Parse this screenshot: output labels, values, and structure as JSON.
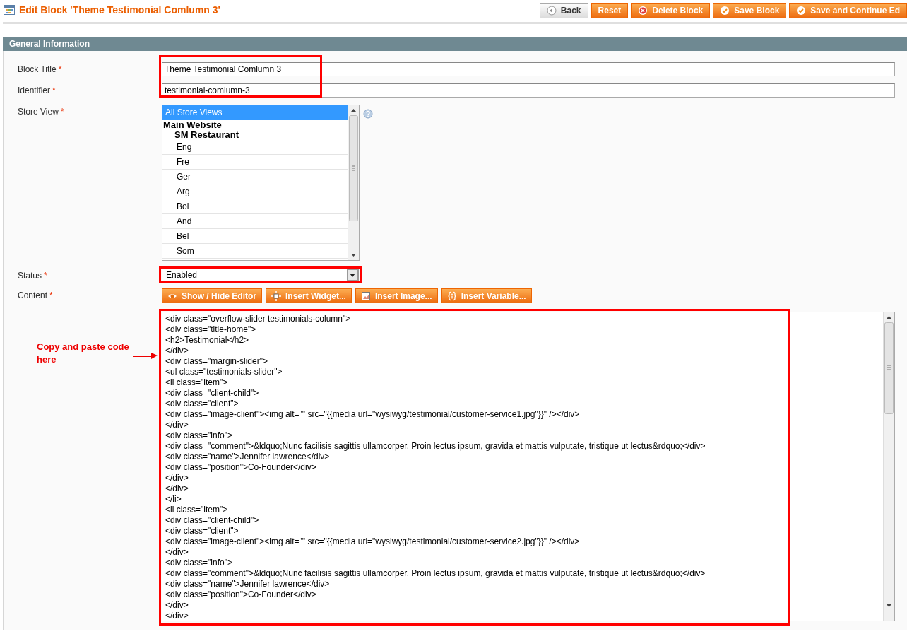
{
  "header": {
    "title": "Edit Block 'Theme Testimonial Comlumn 3'",
    "buttons": [
      {
        "label": "Back",
        "kind": "back"
      },
      {
        "label": "Reset",
        "kind": "plain"
      },
      {
        "label": "Delete Block",
        "kind": "delete"
      },
      {
        "label": "Save Block",
        "kind": "save"
      },
      {
        "label": "Save and Continue Ed",
        "kind": "save"
      }
    ]
  },
  "fieldset": {
    "title": "General Information",
    "block_title": {
      "label": "Block Title",
      "required_mark": "*",
      "value": "Theme Testimonial Comlumn 3"
    },
    "identifier": {
      "label": "Identifier",
      "required_mark": "*",
      "value": "testimonial-comlumn-3"
    },
    "store_view": {
      "label": "Store View",
      "required_mark": "*",
      "options": [
        {
          "label": "All Store Views",
          "kind": "option",
          "selected": true
        },
        {
          "label": "Main Website",
          "kind": "group",
          "children": [
            {
              "label": "SM Restaurant",
              "kind": "group",
              "children": [
                {
                  "label": "Eng",
                  "kind": "option",
                  "selected": false
                },
                {
                  "label": "Fre",
                  "kind": "option",
                  "selected": false
                },
                {
                  "label": "Ger",
                  "kind": "option",
                  "selected": false
                },
                {
                  "label": "Arg",
                  "kind": "option",
                  "selected": false
                },
                {
                  "label": "Bol",
                  "kind": "option",
                  "selected": false
                },
                {
                  "label": "And",
                  "kind": "option",
                  "selected": false
                },
                {
                  "label": "Bel",
                  "kind": "option",
                  "selected": false
                },
                {
                  "label": "Som",
                  "kind": "option",
                  "selected": false
                }
              ]
            }
          ]
        }
      ]
    },
    "status": {
      "label": "Status",
      "required_mark": "*",
      "value": "Enabled"
    },
    "content": {
      "label": "Content",
      "required_mark": "*",
      "buttons": [
        {
          "label": "Show / Hide Editor",
          "kind": "editor"
        },
        {
          "label": "Insert Widget...",
          "kind": "widget"
        },
        {
          "label": "Insert Image...",
          "kind": "image"
        },
        {
          "label": "Insert Variable...",
          "kind": "variable"
        }
      ],
      "lines": [
        "<div class=\"overflow-slider testimonials-column\">",
        "<div class=\"title-home\">",
        "<h2>Testimonial</h2>",
        "</div>",
        "<div class=\"margin-slider\">",
        "<ul class=\"testimonials-slider\">",
        "<li class=\"item\">",
        "<div class=\"client-child\">",
        "<div class=\"client\">",
        "<div class=\"image-client\"><img alt=\"\" src=\"{{media url=\"wysiwyg/testimonial/customer-service1.jpg\"}}\" /></div>",
        "</div>",
        "<div class=\"info\">",
        "<div class=\"comment\">&ldquo;Nunc facilisis sagittis ullamcorper. Proin lectus ipsum, gravida et mattis vulputate, tristique ut lectus&rdquo;</div>",
        "<div class=\"name\">Jennifer lawrence</div>",
        "<div class=\"position\">Co-Founder</div>",
        "</div>",
        "</div>",
        "</li>",
        "<li class=\"item\">",
        "<div class=\"client-child\">",
        "<div class=\"client\">",
        "<div class=\"image-client\"><img alt=\"\" src=\"{{media url=\"wysiwyg/testimonial/customer-service2.jpg\"}}\" /></div>",
        "</div>",
        "<div class=\"info\">",
        "<div class=\"comment\">&ldquo;Nunc facilisis sagittis ullamcorper. Proin lectus ipsum, gravida et mattis vulputate, tristique ut lectus&rdquo;</div>",
        "<div class=\"name\">Jennifer lawrence</div>",
        "<div class=\"position\">Co-Founder</div>",
        "</div>",
        "</div>"
      ]
    }
  },
  "annotation": {
    "note": "Copy and paste code here"
  }
}
